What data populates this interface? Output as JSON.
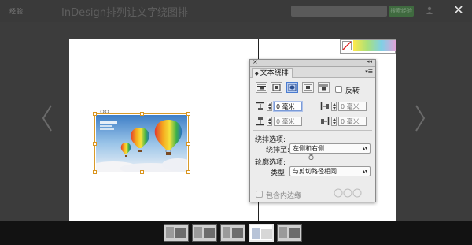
{
  "header": {
    "brand": "经验",
    "title": "InDesign排列让文字绕图排",
    "search_placeholder": "",
    "search_button": "搜索经验"
  },
  "panel": {
    "tab_label": "文本绕排",
    "invert_label": "反转",
    "offsets": {
      "top": "0 毫米",
      "bottom": "0 毫米",
      "left": "0 毫米",
      "right": "0 毫米"
    },
    "wrap_options_heading": "绕排选项:",
    "wrap_to_label": "绕排至:",
    "wrap_to_value": "左侧和右侧",
    "contour_options_heading": "轮廓选项:",
    "type_label": "类型:",
    "type_value": "与剪切路径相同",
    "include_inside_edges_label": "包含内边缘"
  },
  "icons": {
    "close_viewer": "close-icon",
    "prev": "chevron-left-icon",
    "next": "chevron-right-icon",
    "panel_close": "close-icon",
    "panel_collapse": "collapse-icon",
    "panel_menu": "panel-menu-icon"
  },
  "colors": {
    "accent_green": "#3f6a3f",
    "selection_orange": "#d99b2a",
    "active_wrap_blue": "#4a7cd0",
    "guide_blue": "#8f95d8",
    "margin_red": "#d92a2a"
  },
  "filmstrip": {
    "count": 5,
    "active_index": 3
  }
}
